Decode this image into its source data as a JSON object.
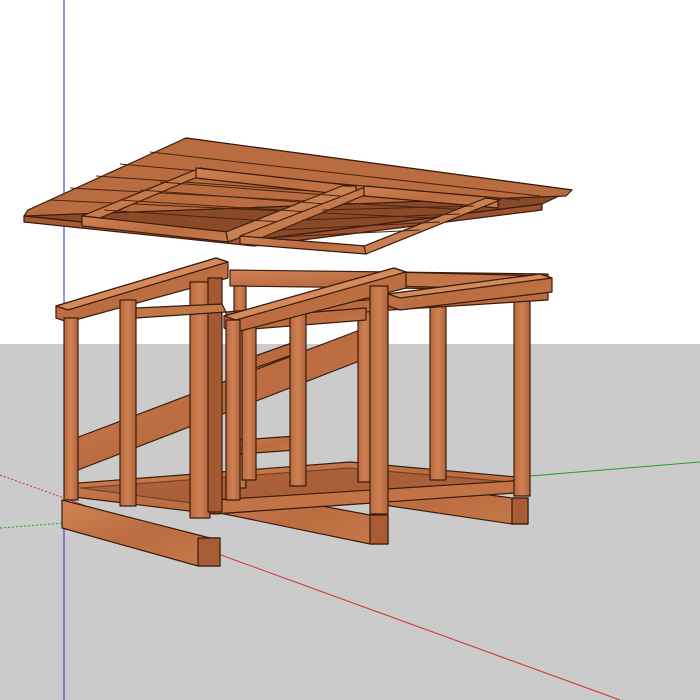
{
  "scene": {
    "sky_color": "#ffffff",
    "ground_color": "#cbcbcb",
    "wood_light": "#c9794a",
    "wood_mid": "#b2643a",
    "wood_dark": "#8a4a28",
    "wood_edge": "#3a1c0c",
    "axis_colors": {
      "blue": "#2a2ad8",
      "red": "#d03030",
      "green": "#22a022"
    }
  }
}
